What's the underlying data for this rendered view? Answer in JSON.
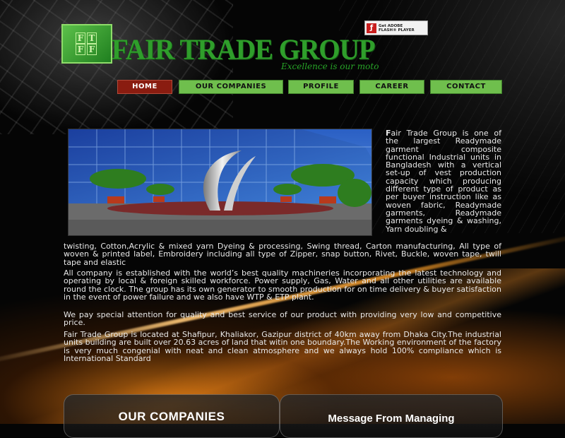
{
  "brand": {
    "logo_letters": [
      "F",
      "T",
      "F",
      "F"
    ],
    "title": "FAIR TRADE GROUP",
    "tagline": "Excellence is our moto",
    "flash_badge": {
      "line1": "Get ADOBE",
      "line2": "FLASH® PLAYER"
    },
    "colors": {
      "brand_green": "#2f9e2b",
      "nav_green": "#6fbf4d",
      "nav_active": "#8a1c10",
      "accent_orange": "#ff8c14"
    }
  },
  "nav": {
    "items": [
      {
        "label": "HOME",
        "active": true
      },
      {
        "label": "OUR COMPANIES",
        "active": false
      },
      {
        "label": "PROFILE",
        "active": false
      },
      {
        "label": "CAREER",
        "active": false
      },
      {
        "label": "CONTACT",
        "active": false
      }
    ]
  },
  "content": {
    "intro_dropcap": "F",
    "intro_right": "air Trade Group is one of the largest Readymade garment composite functional Industrial units in Bangladesh with a vertical set-up of vest production capacity which producing different type of product as per buyer instruction like as woven fabric, Readymade garments, Readymade garments dyeing & washing, Yarn doubling &",
    "intro_full": "twisting, Cotton,Acrylic & mixed yarn Dyeing & processing, Swing thread, Carton manufacturing, All type of woven & printed label, Embroidery including all type of Zipper, snap button, Rivet, Buckle, woven tape, twill tape and elastic",
    "para2": "All company is established with the world’s best quality machineries incorporating the latest technology and operating by local & foreign skilled workforce. Power supply, Gas, Water and all other utilities are available round the clock. The group has its own generator to smooth production for on time delivery & buyer satisfaction in the event of power failure and we also have WTP & ETP plant.",
    "para3": "We pay special attention for quality and best service of our product with providing very low and competitive price.",
    "para4": "Fair Trade Group is located at Shafipur, Khaliakor, Gazipur district of 40km away from  Dhaka City.The industrial units building are built over 20.63 acres of land that witin one boundary.The Working environment of the factory is very much congenial with neat and clean atmosphere and we always hold 100% compliance which is International Standard"
  },
  "panels": {
    "left_title": "OUR COMPANIES",
    "right_title": "Message From Managing"
  },
  "icons": {
    "flash": "flash-player-icon",
    "logo": "ftf-logo-icon"
  }
}
